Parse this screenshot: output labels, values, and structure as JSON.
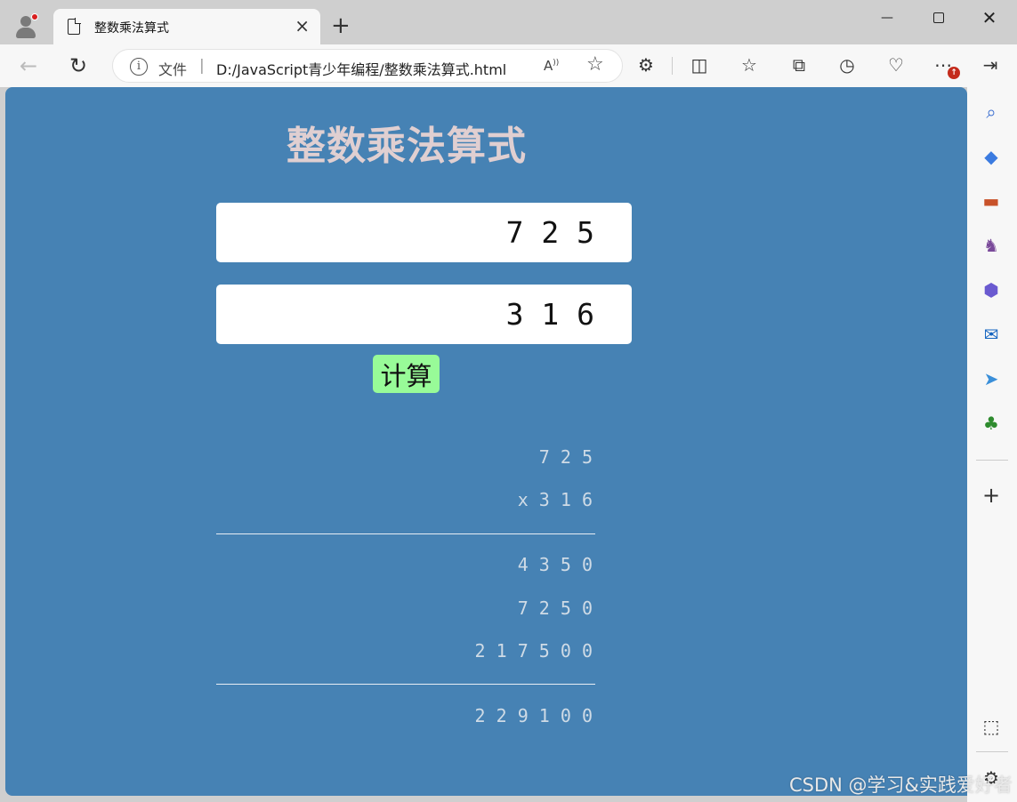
{
  "browser": {
    "tab_title": "整数乘法算式",
    "new_tab_symbol": "+",
    "close_symbol": "×",
    "window": {
      "minimize": "—",
      "close": "✕"
    },
    "address": {
      "scheme_label": "文件",
      "separator": "|",
      "url": "D:/JavaScript青少年编程/整数乘法算式.html"
    },
    "update_badge": "↑"
  },
  "page": {
    "heading": "整数乘法算式",
    "input_a": "7 2 5",
    "input_b": "3 1 6",
    "button_label": "计算",
    "steps": {
      "multiplicand": "7 2 5",
      "multiplier": "x 3 1 6",
      "partial_1": "4 3 5 0",
      "partial_2": "7 2 5 0",
      "partial_3": "2 1 7 5 0 0",
      "result": "2 2 9 1 0 0"
    },
    "colors": {
      "page_bg": "#4682b4",
      "heading": "#e0cfd1",
      "button_bg": "#98fb98",
      "work_text": "#cfdbe6"
    }
  },
  "watermark": "CSDN @学习&实践爱好者"
}
